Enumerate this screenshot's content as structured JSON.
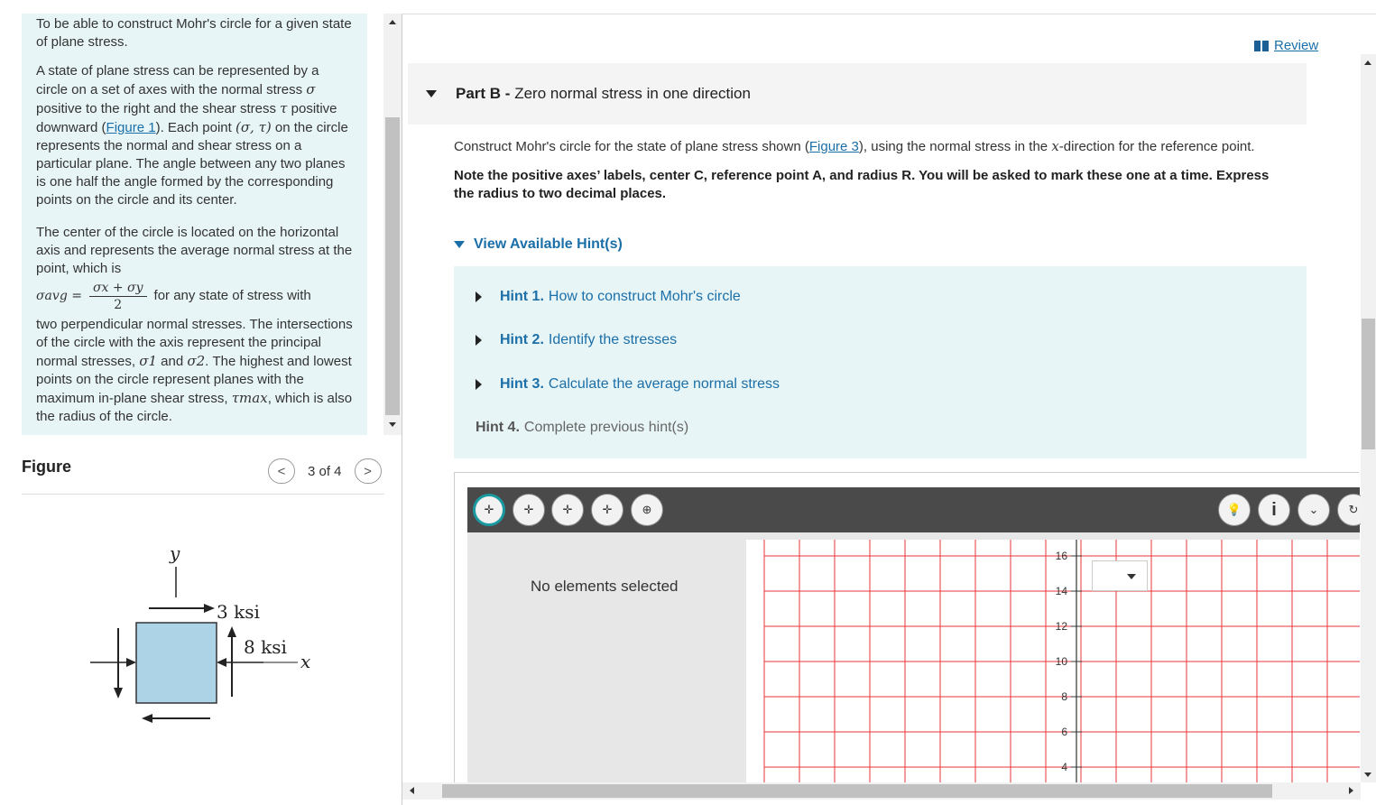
{
  "intro": {
    "p1": "To be able to construct Mohr's circle for a given state of plane stress.",
    "p2_a": "A state of plane stress can be represented by a circle on a set of axes with the normal stress ",
    "p2_sigma": "σ",
    "p2_b": " positive to the right and the shear stress ",
    "p2_tau": "τ",
    "p2_c": " positive downward (",
    "p2_link": "Figure 1",
    "p2_d": "). Each point ",
    "p2_point": "(σ, τ)",
    "p2_e": " on the circle represents the normal and shear stress on a particular plane. The angle between any two planes is one half the angle formed by the corresponding points on the circle and its center.",
    "p3_a": "The center of the circle is located on the horizontal axis and represents the average normal stress at the point, which is",
    "formula_lhs": "σavg =",
    "formula_num": "σx + σy",
    "formula_den": "2",
    "formula_tail": "for any state of stress with",
    "p3_b": "two perpendicular normal stresses. The intersections of the circle with the axis represent the principal normal stresses, ",
    "p3_sig1": "σ1",
    "p3_and": " and ",
    "p3_sig2": "σ2",
    "p3_c": ". The highest and lowest points on the circle represent planes with the maximum in-plane shear stress,",
    "p3_tmax": "τmax",
    "p3_d": ", which is also the radius of the circle."
  },
  "figure": {
    "title": "Figure",
    "count": "3 of 4",
    "prev": "<",
    "next": ">",
    "axis_y": "y",
    "axis_x": "x",
    "stress_shear": "3 ksi",
    "stress_normal": "8 ksi"
  },
  "review": "Review",
  "part": {
    "prefix": "Part B -",
    "title": "Zero normal stress in one direction"
  },
  "question": {
    "text_a": "Construct Mohr's circle for the state of plane stress shown (",
    "link": "Figure 3",
    "text_b": "), using the normal stress in the ",
    "xvar": "x",
    "text_c": "-direction for the reference point.",
    "note": "Note the positive axes’ labels, center C, reference point A, and radius R. You will be asked to mark these one at a time. Express the radius to two decimal places."
  },
  "hints": {
    "toggle": "View Available Hint(s)",
    "items": [
      {
        "num": "Hint 1.",
        "text": "How to construct Mohr's circle"
      },
      {
        "num": "Hint 2.",
        "text": "Identify the stresses"
      },
      {
        "num": "Hint 3.",
        "text": "Calculate the average normal stress"
      },
      {
        "num": "Hint 4.",
        "text": "Complete previous hint(s)"
      }
    ]
  },
  "tool": {
    "side_message": "No elements selected",
    "y_ticks": [
      "16",
      "14",
      "12",
      "10",
      "8",
      "6",
      "4"
    ],
    "colors": {
      "grid": "#e8353b",
      "toolbar": "#4a4a4a",
      "active": "#1a9aa0"
    }
  }
}
